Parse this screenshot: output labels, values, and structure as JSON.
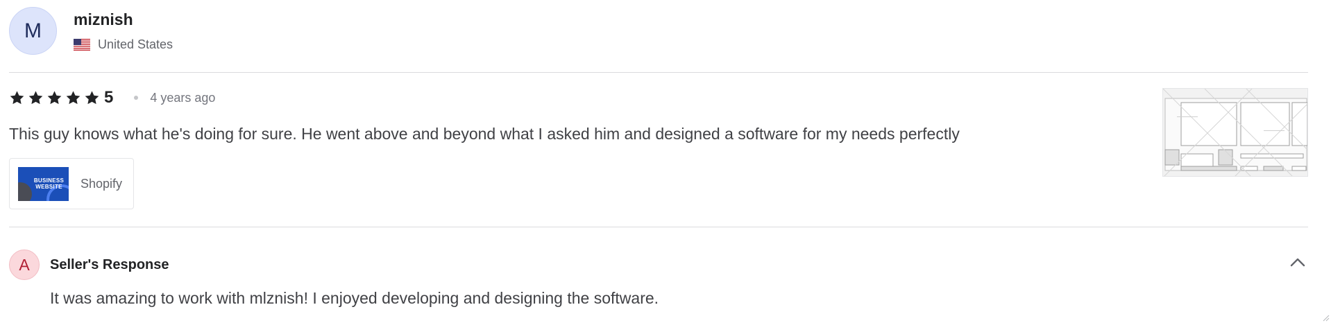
{
  "reviewer": {
    "avatar_initial": "M",
    "name": "miznish",
    "country": "United States",
    "flag_icon": "us-flag-icon"
  },
  "review": {
    "star_count": 5,
    "rating": "5",
    "time_ago": "4 years ago",
    "text": "This guy knows what he's doing for sure. He went above and beyond what I asked him and designed a software for my needs perfectly",
    "gig_tag": {
      "thumbnail_text": "BUSINESS WEBSITE",
      "label": "Shopify"
    },
    "attachment_icon": "review-attachment-thumbnail"
  },
  "seller_response": {
    "avatar_initial": "A",
    "title": "Seller's Response",
    "text": "It was amazing to work with mlznish! I enjoyed developing and designing the software.",
    "collapse_icon": "chevron-up-icon"
  },
  "colors": {
    "star": "#222325",
    "reviewer_avatar_bg": "#dde4fb",
    "seller_avatar_bg": "#fbd8dc",
    "divider": "#dadbdd"
  }
}
